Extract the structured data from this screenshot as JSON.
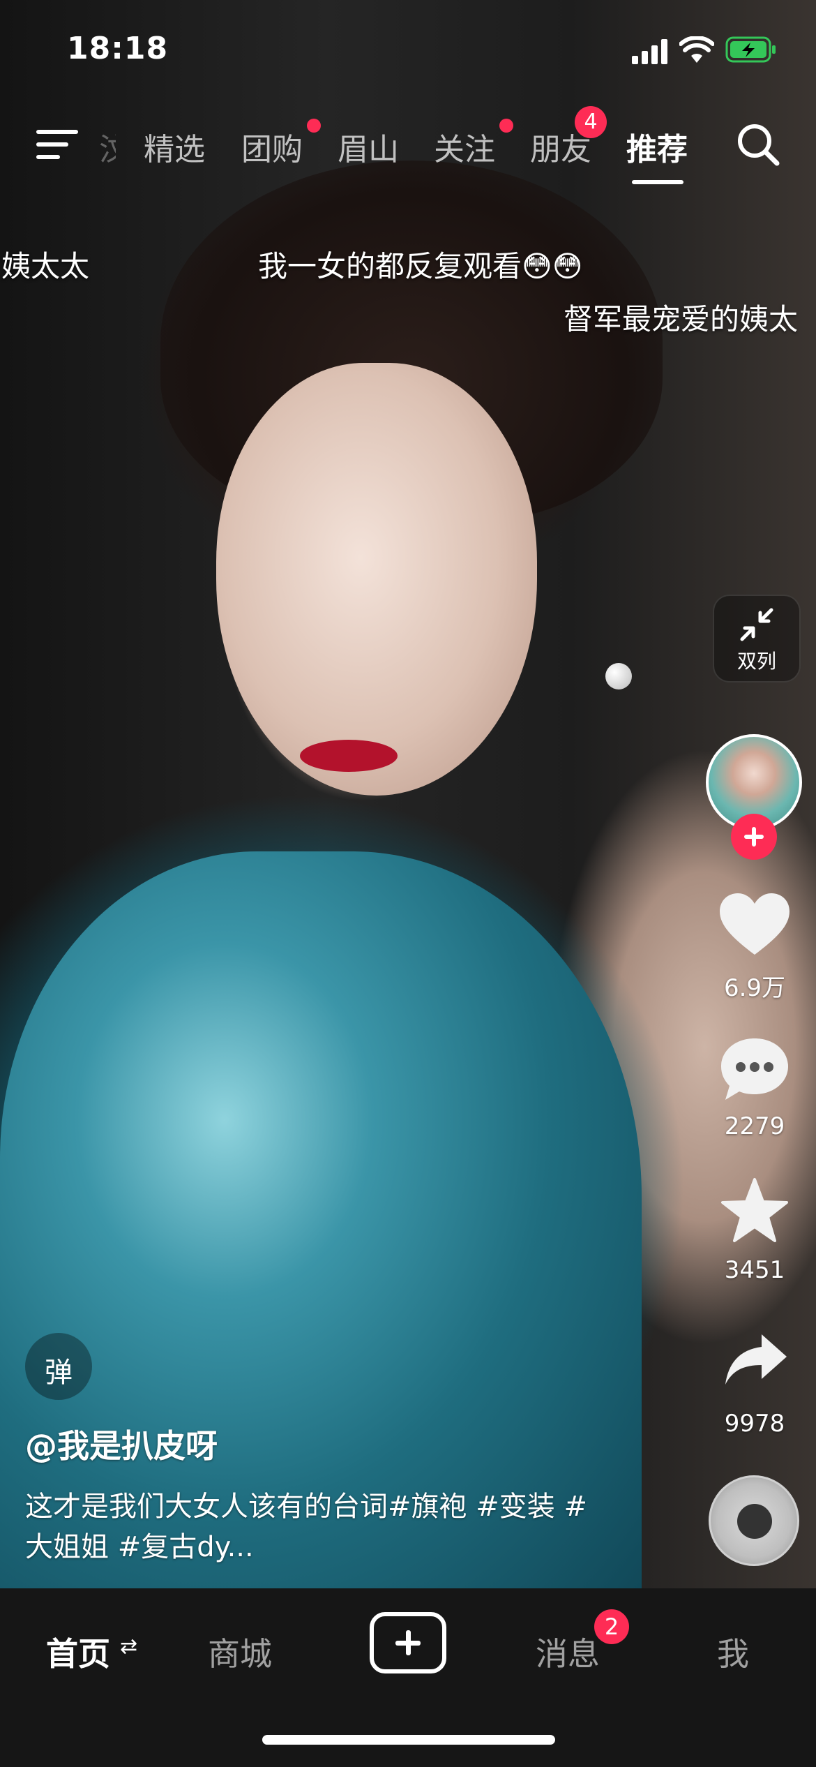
{
  "status_bar": {
    "time": "18:18"
  },
  "top_nav": {
    "tabs": [
      {
        "label": "精选",
        "active": false,
        "dot": false
      },
      {
        "label": "团购",
        "active": false,
        "dot": true
      },
      {
        "label": "眉山",
        "active": false,
        "dot": false
      },
      {
        "label": "关注",
        "active": false,
        "dot": true
      },
      {
        "label": "朋友",
        "active": false,
        "badge": "4"
      },
      {
        "label": "推荐",
        "active": true
      }
    ],
    "partial_tab": "汶"
  },
  "danmaku": [
    {
      "text": "姨太太"
    },
    {
      "text": "我一女的都反复观看😳😳"
    },
    {
      "text": "督军最宠爱的姨太"
    }
  ],
  "side_actions": {
    "dual_column_label": "双列",
    "likes": "6.9万",
    "comments": "2279",
    "favorites": "3451",
    "shares": "9978"
  },
  "video_info": {
    "danmaku_toggle": "弹",
    "author": "@我是扒皮呀",
    "caption_line1": "这才是我们大女人该有的台词#旗袍 #变装 #",
    "caption_line2": "大姐姐 #复古dy..."
  },
  "bottom_tabs": {
    "home": "首页",
    "mall": "商城",
    "messages": "消息",
    "messages_badge": "2",
    "me": "我"
  },
  "colors": {
    "accent": "#fe2c55",
    "battery": "#34c759"
  }
}
